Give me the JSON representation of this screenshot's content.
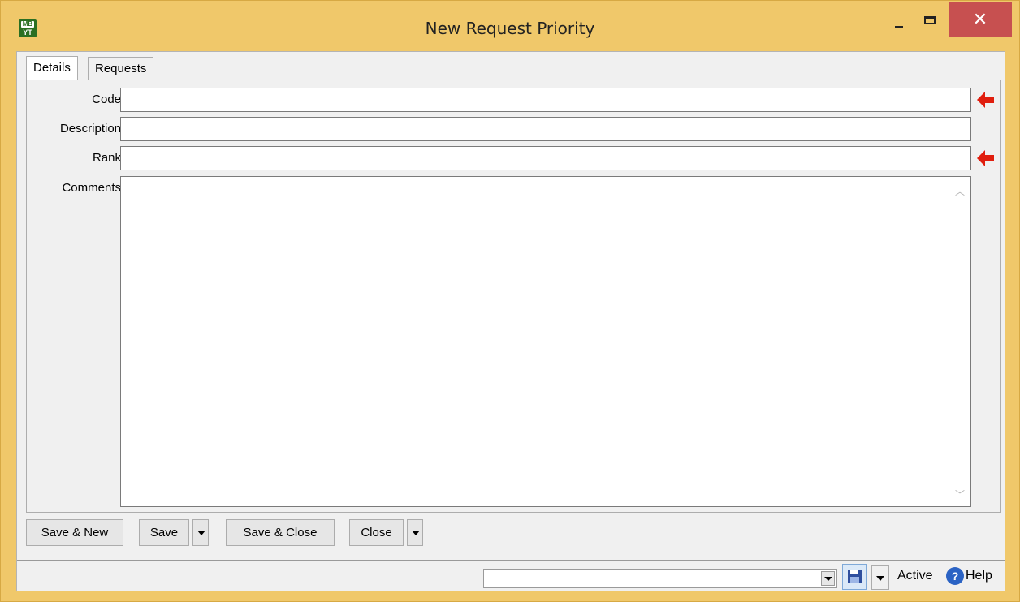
{
  "window": {
    "title": "New Request Priority",
    "icon_text_top": "MB",
    "icon_text_bottom": "YT",
    "close_glyph": "✕"
  },
  "tabs": [
    {
      "label": "Details"
    },
    {
      "label": "Requests"
    }
  ],
  "form": {
    "code_label": "Code",
    "description_label": "Description",
    "rank_label": "Rank",
    "comments_label": "Comments",
    "code_value": "",
    "description_value": "",
    "rank_value": "",
    "comments_value": ""
  },
  "buttons": {
    "save_new": "Save & New",
    "save": "Save",
    "save_close": "Save & Close",
    "close": "Close"
  },
  "statusbar": {
    "combo_value": "",
    "status": "Active",
    "help": "Help"
  },
  "icons": {
    "required": "red-left-arrow-icon",
    "help": "help-circle-icon",
    "save_state": "floppy-disk-icon"
  },
  "colors": {
    "titlebar": "#f0c86a",
    "close_button": "#c75050",
    "required_arrow": "#e01e0e"
  }
}
